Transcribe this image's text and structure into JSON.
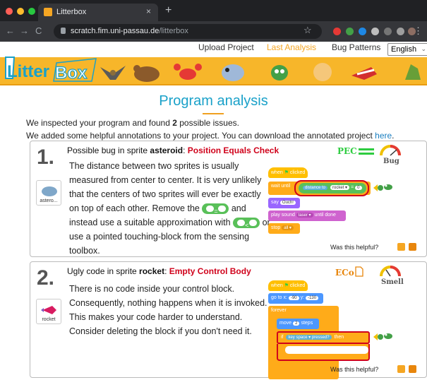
{
  "browser": {
    "tab_title": "Litterbox",
    "url_host": "scratch.fim.uni-passau.de",
    "url_path": "/litterbox"
  },
  "site": {
    "logo_text": "LitterBox",
    "nav": {
      "upload": "Upload Project",
      "last_analysis": "Last Analysis",
      "bug_patterns": "Bug Patterns",
      "language": "English"
    }
  },
  "page": {
    "title": "Program analysis",
    "intro_line1_pre": "We inspected your program and found ",
    "intro_count": "2",
    "intro_line1_post": " possible issues.",
    "intro_line2": "We added some helpful annotations to your project. You can download the annotated project ",
    "intro_link": "here",
    "intro_period": "."
  },
  "issues": [
    {
      "number": "1.",
      "heading_pre": "Possible bug in sprite ",
      "sprite": "asteroid",
      "heading_sep": ": ",
      "type": "Position Equals Check",
      "thumb_caption": "astero...",
      "body_1": "The distance between two sprites is usually measured from center to center. It is very unlikely that the centers of two sprites will ever be exactly on top of each other. Remove the",
      "op_eq": "=",
      "body_2": "and instead use a suitable approximation with",
      "op_lt": "<",
      "body_3": "or use a pointed touching-block from the sensing toolbox.",
      "code": "PEC",
      "severity": "Bug",
      "helpful": "Was this helpful?",
      "blocks": {
        "hat": "when",
        "hat2": "clicked",
        "wait": "wait until",
        "distance": "distance to",
        "target": "rocket ▾",
        "eq": "=",
        "zero": "0",
        "say": "say",
        "say_val": "Ouch!",
        "sound": "play sound",
        "sound_val": "laser ▾",
        "sound_end": "until done",
        "stop": "stop",
        "stop_val": "all ▾"
      }
    },
    {
      "number": "2.",
      "heading_pre": "Ugly code in sprite ",
      "sprite": "rocket",
      "heading_sep": ": ",
      "type": "Empty Control Body",
      "thumb_caption": "rocket",
      "body": "There is no code inside your control block. Consequently, nothing happens when it is invoked. This makes your code harder to understand. Consider deleting the block if you don't need it.",
      "code": "ECo",
      "severity": "Smell",
      "helpful": "Was this helpful?",
      "blocks": {
        "hat": "when",
        "hat2": "clicked",
        "goto": "go to x:",
        "x": "-90",
        "y_lbl": "y:",
        "y": "-130",
        "forever": "forever",
        "move": "move",
        "steps_val": "2",
        "steps": "steps",
        "if": "if",
        "key": "key",
        "key_val": "space ▾",
        "pressed": "pressed?",
        "then": "then"
      }
    }
  ],
  "colors": {
    "accent": "#1aa1c9",
    "warning": "#d0021b",
    "banner": "#f7b62a",
    "active_nav": "#f5a623"
  }
}
